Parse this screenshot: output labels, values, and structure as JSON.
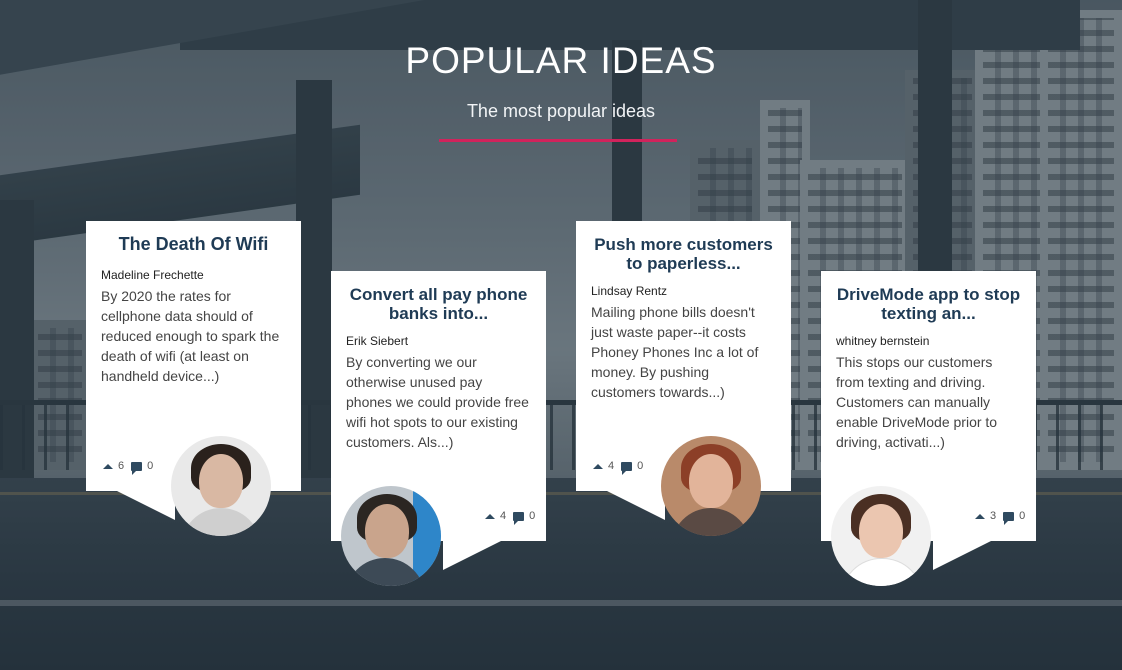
{
  "header": {
    "title": "POPULAR IDEAS",
    "subtitle": "The most popular ideas"
  },
  "accent_color": "#d1235c",
  "title_color": "#1f3b55",
  "ideas": [
    {
      "title": "The Death Of Wifi",
      "author": "Madeline Frechette",
      "excerpt": "By 2020 the rates for cellphone data should of reduced enough to spark the death of wifi (at least on handheld device...)",
      "votes": "6",
      "comments": "0",
      "avatar_icon": "avatar-woman-dark-hair"
    },
    {
      "title": "Convert all pay phone banks into...",
      "author": "Erik Siebert",
      "excerpt": "By converting we our otherwise unused pay phones we could provide free wifi hot spots to our existing customers. Als...)",
      "votes": "4",
      "comments": "0",
      "avatar_icon": "avatar-man-beard",
      "avatar_badge": "ideascale"
    },
    {
      "title": "Push more customers to paperless...",
      "author": "Lindsay Rentz",
      "excerpt": "Mailing phone bills doesn't just waste paper--it costs Phoney Phones Inc a lot of money. By pushing customers towards...)",
      "votes": "4",
      "comments": "0",
      "avatar_icon": "avatar-woman-red-hair"
    },
    {
      "title": "DriveMode app to stop texting an...",
      "author": "whitney bernstein",
      "excerpt": "This stops our customers from texting and driving. Customers can manually enable DriveMode prior to driving, activati...)",
      "votes": "3",
      "comments": "0",
      "avatar_icon": "avatar-woman-smiling"
    }
  ]
}
